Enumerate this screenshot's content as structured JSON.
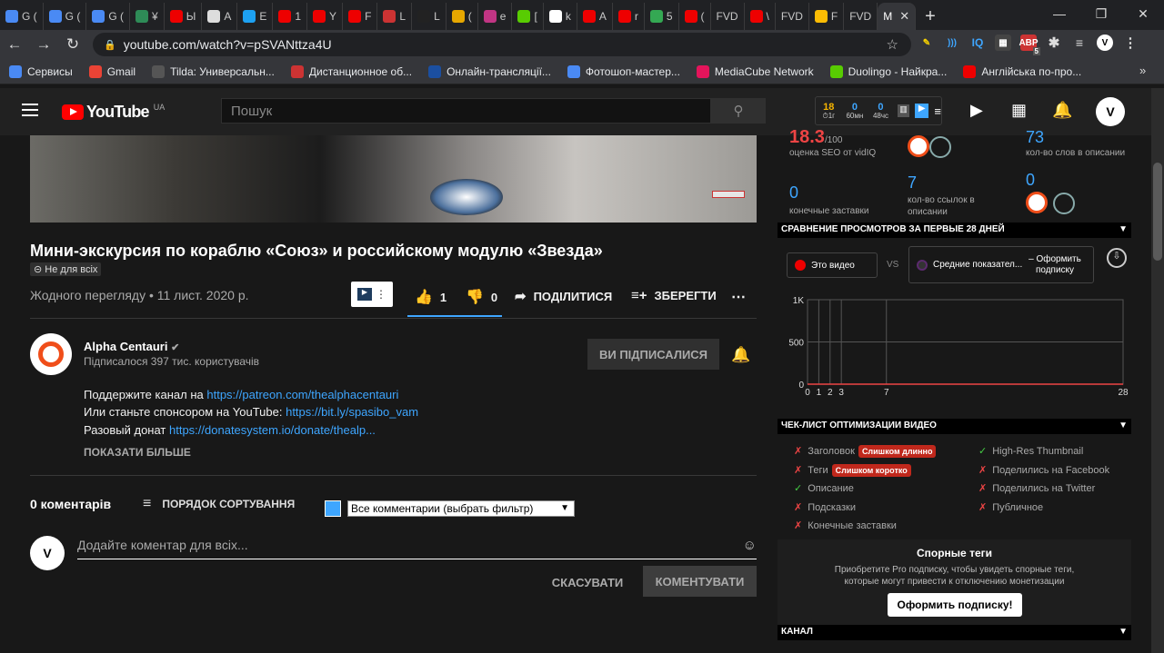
{
  "browser": {
    "tabs": [
      {
        "label": "G (",
        "color": "#4a8af4"
      },
      {
        "label": "G (",
        "color": "#4a8af4"
      },
      {
        "label": "G (",
        "color": "#4a8af4"
      },
      {
        "label": "¥",
        "color": "#2e8b57"
      },
      {
        "label": "Ы",
        "color": "#e00"
      },
      {
        "label": "A",
        "color": "#ddd"
      },
      {
        "label": "E",
        "color": "#1da1f2"
      },
      {
        "label": "1",
        "color": "#e00"
      },
      {
        "label": "Y",
        "color": "#e00"
      },
      {
        "label": "F",
        "color": "#e00"
      },
      {
        "label": "L",
        "color": "#c33"
      },
      {
        "label": "L",
        "color": "#222"
      },
      {
        "label": "(",
        "color": "#e6a700"
      },
      {
        "label": "e",
        "color": "#c13584"
      },
      {
        "label": "[",
        "color": "#58cc02"
      },
      {
        "label": "k",
        "color": "#fff"
      },
      {
        "label": "A",
        "color": "#e00"
      },
      {
        "label": "r",
        "color": "#e00"
      },
      {
        "label": "5",
        "color": "#34a853"
      },
      {
        "label": "(",
        "color": "#e00"
      },
      {
        "label": "FVD",
        "color": ""
      },
      {
        "label": "\\",
        "color": "#e00"
      },
      {
        "label": "FVD",
        "color": ""
      },
      {
        "label": "F",
        "color": "#fbbc04"
      },
      {
        "label": "FVD",
        "color": ""
      },
      {
        "label": "M",
        "color": "",
        "active": true
      }
    ],
    "new_tab": "+",
    "address": "youtube.com/watch?v=pSVANttza4U",
    "bookmarks": [
      {
        "label": "Сервисы",
        "color": "#4a8af4"
      },
      {
        "label": "Gmail",
        "color": "#ea4335"
      },
      {
        "label": "Tilda: Универсальн...",
        "color": "#555"
      },
      {
        "label": "Дистанционное об...",
        "color": "#c33"
      },
      {
        "label": "Онлайн-трансляції...",
        "color": "#1b4fa0"
      },
      {
        "label": "Фотошоп-мастер...",
        "color": "#4a8af4"
      },
      {
        "label": "MediaCube Network",
        "color": "#e4145b"
      },
      {
        "label": "Duolingo - Найкра...",
        "color": "#58cc02"
      },
      {
        "label": "Англійська по-про...",
        "color": "#e00"
      }
    ],
    "more": "»",
    "ext_badge": "5"
  },
  "masthead": {
    "logo": "YouTube",
    "country": "UA",
    "search_placeholder": "Пошук",
    "vidiq_stats": [
      {
        "value": "18",
        "label": "⏱1г",
        "color": "#f5b400"
      },
      {
        "value": "0",
        "label": "60мн",
        "color": "#3ea6ff"
      },
      {
        "value": "0",
        "label": "48чс",
        "color": "#3ea6ff"
      }
    ],
    "avatar_letter": "V"
  },
  "video": {
    "title": "Мини-экскурсия по кораблю «Союз» и российскому модулю «Звезда»",
    "unlisted": "Не для всіх",
    "views_date": "Жодного перегляду • 11 лист. 2020 р.",
    "likes": "1",
    "dislikes": "0",
    "share": "ПОДІЛИТИСЯ",
    "save": "ЗБЕРЕГТИ"
  },
  "channel": {
    "name": "Alpha Centauri",
    "subs": "Підписалося 397 тис. користувачів",
    "subscribed_label": "ВИ ПІДПИСАЛИСЯ",
    "desc": [
      {
        "text": "Поддержите канал на ",
        "link": "https://patreon.com/thealphacentauri"
      },
      {
        "text": "Или станьте спонсором на YouTube: ",
        "link": "https://bit.ly/spasibo_vam"
      },
      {
        "text": "Разовый донат ",
        "link": "https://donatesystem.io/donate/thealp..."
      }
    ],
    "show_more": "ПОКАЗАТИ БІЛЬШЕ"
  },
  "comments": {
    "count": "0 коментарів",
    "sort": "ПОРЯДОК СОРТУВАННЯ",
    "filter": "Все комментарии (выбрать фильтр)",
    "placeholder": "Додайте коментар для всіх...",
    "cancel": "СКАСУВАТИ",
    "submit": "КОМЕНТУВАТИ"
  },
  "panel": {
    "seo_score": "18.3",
    "seo_max": "/100",
    "seo_label": "оценка SEO от vidIQ",
    "desc_words": "73",
    "desc_words_label": "кол-во слов в описании",
    "end_screens": "0",
    "end_screens_label": "конечные заставки",
    "links": "7",
    "links_label": "кол-во ссылок в описании",
    "cards": "0",
    "compare_title": "СРАВНЕНИЕ ПРОСМОТРОВ ЗА ПЕРВЫЕ 28 ДНЕЙ",
    "this_video": "Это видео",
    "vs": "VS",
    "averages": "Средние показател...",
    "subscribe_opt": "– Оформить подписку",
    "checklist_title": "ЧЕК-ЛИСТ ОПТИМИЗАЦИИ ВИДЕО",
    "checklist_left": [
      {
        "ok": false,
        "label": "Заголовок",
        "badge": "Слишком длинно"
      },
      {
        "ok": false,
        "label": "Теги",
        "badge": "Слишком коротко"
      },
      {
        "ok": true,
        "label": "Описание",
        "badge": ""
      },
      {
        "ok": false,
        "label": "Подсказки",
        "badge": ""
      },
      {
        "ok": false,
        "label": "Конечные заставки",
        "badge": ""
      }
    ],
    "checklist_right": [
      {
        "ok": true,
        "label": "High-Res Thumbnail"
      },
      {
        "ok": false,
        "label": "Поделились на Facebook"
      },
      {
        "ok": false,
        "label": "Поделились на Twitter"
      },
      {
        "ok": false,
        "label": "Публичное"
      }
    ],
    "dispute_title": "Спорные теги",
    "dispute_desc": "Приобретите Pro подписку, чтобы увидеть спорные теги, которые могут привести к отключению монетизации",
    "dispute_btn": "Оформить подписку!",
    "channel_title": "КАНАЛ"
  },
  "chart_data": {
    "type": "line",
    "title": "",
    "x_ticks": [
      "0",
      "1",
      "2",
      "3",
      "7",
      "28"
    ],
    "xlim": [
      0,
      28
    ],
    "y_ticks": [
      "1K",
      "500",
      "0"
    ],
    "ylim": [
      0,
      1000
    ],
    "series": [
      {
        "values": [
          0,
          0,
          0,
          0,
          0,
          0
        ],
        "color": "#e44"
      }
    ],
    "grid": true
  }
}
